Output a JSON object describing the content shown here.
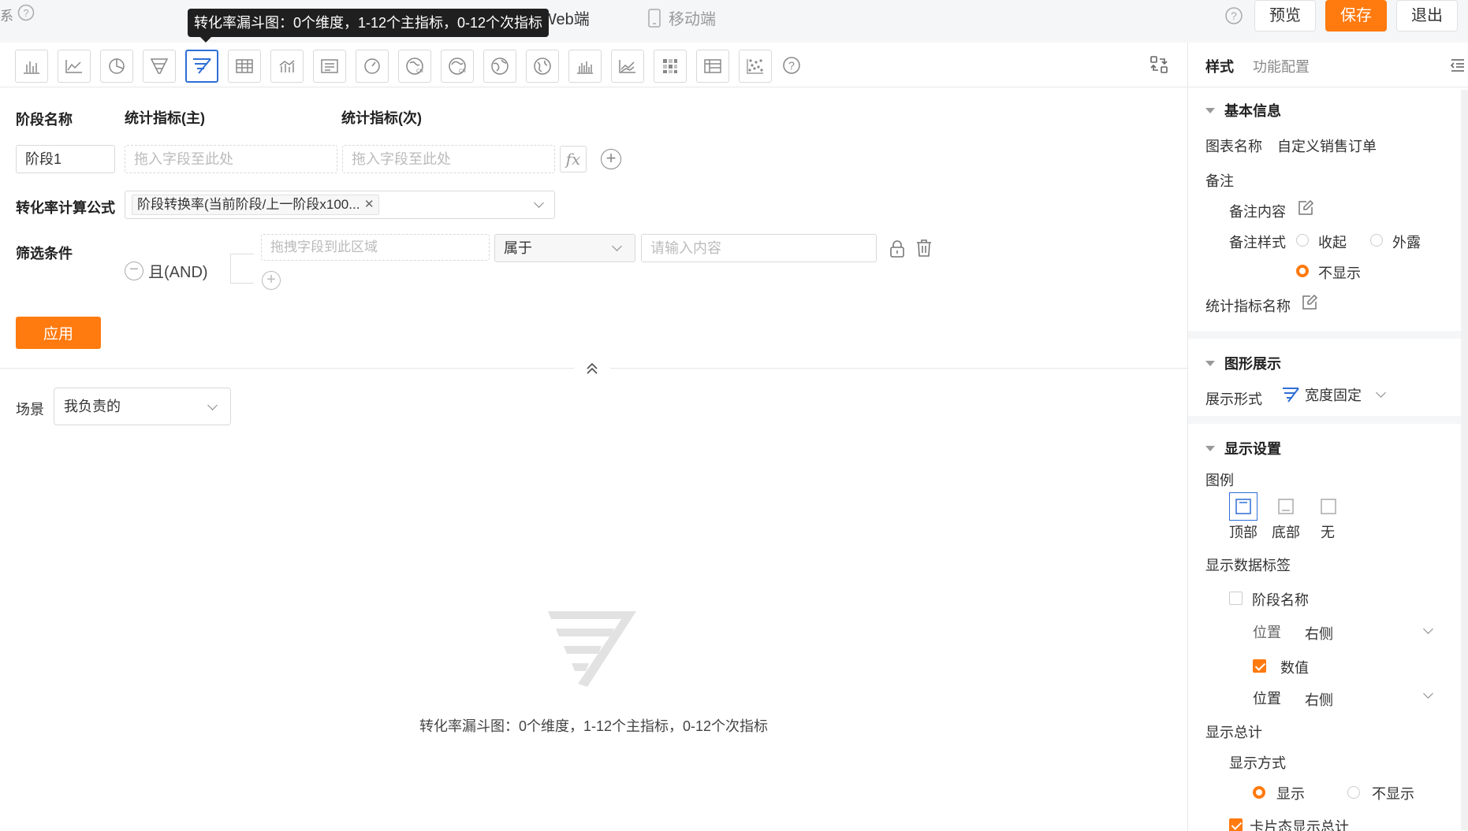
{
  "topbar": {
    "sys_fragment": "系",
    "tooltip": "转化率漏斗图：0个维度，1-12个主指标，0-12个次指标",
    "web_tab": "Web端",
    "mobile_tab": "移动端",
    "preview_label": "预览",
    "save_label": "保存",
    "exit_label": "退出"
  },
  "toolbar": {
    "icons": [
      "bar-chart-icon",
      "line-chart-icon",
      "pie-chart-icon",
      "funnel-chart-icon",
      "conversion-funnel-icon",
      "table-icon",
      "combo-chart-icon",
      "text-card-icon",
      "gauge-icon",
      "china-map-icon",
      "china-map-alt-icon",
      "world-map-icon",
      "globe-map-icon",
      "histogram-icon",
      "area-chart-icon",
      "heatmap-icon",
      "pivot-table-icon",
      "scatter-plot-icon"
    ],
    "active_index": 4
  },
  "config": {
    "stage_name_header": "阶段名称",
    "main_metric_header": "统计指标(主)",
    "sub_metric_header": "统计指标(次)",
    "stage_value": "阶段1",
    "drop_placeholder_main": "拖入字段至此处",
    "drop_placeholder_sub": "拖入字段至此处",
    "fx_label": "fx",
    "formula_label": "转化率计算公式",
    "formula_tag": "阶段转换率(当前阶段/上一阶段x100...",
    "filter_label": "筛选条件",
    "and_label": "且(AND)",
    "filter_drop_placeholder": "拖拽字段到此区域",
    "operator_value": "属于",
    "value_placeholder": "请输入内容",
    "apply_label": "应用"
  },
  "scene": {
    "label": "场景",
    "value": "我负责的"
  },
  "empty_state": {
    "text": "转化率漏斗图：0个维度，1-12个主指标，0-12个次指标"
  },
  "panel": {
    "tab_style": "样式",
    "tab_func": "功能配置",
    "basic": {
      "title": "基本信息",
      "chart_name_label": "图表名称",
      "chart_name_value": "自定义销售订单",
      "remark_label": "备注",
      "remark_content_label": "备注内容",
      "remark_style_label": "备注样式",
      "opt_collapse": "收起",
      "opt_expose": "外露",
      "opt_hide": "不显示",
      "metric_name_label": "统计指标名称"
    },
    "graph": {
      "title": "图形展示",
      "form_label": "展示形式",
      "form_value": "宽度固定"
    },
    "display": {
      "title": "显示设置",
      "legend_label": "图例",
      "legend_top": "顶部",
      "legend_bottom": "底部",
      "legend_none": "无",
      "data_label_title": "显示数据标签",
      "stage_name_cb": "阶段名称",
      "position_label_1": "位置",
      "position_value_1": "右侧",
      "value_cb": "数值",
      "position_label_2": "位置",
      "position_value_2": "右侧",
      "total_title": "显示总计",
      "total_mode_label": "显示方式",
      "total_show": "显示",
      "total_hide": "不显示",
      "card_total": "卡片态显示总计"
    }
  },
  "colors": {
    "accent": "#ff7a0f",
    "active_blue": "#2f6fd6"
  }
}
